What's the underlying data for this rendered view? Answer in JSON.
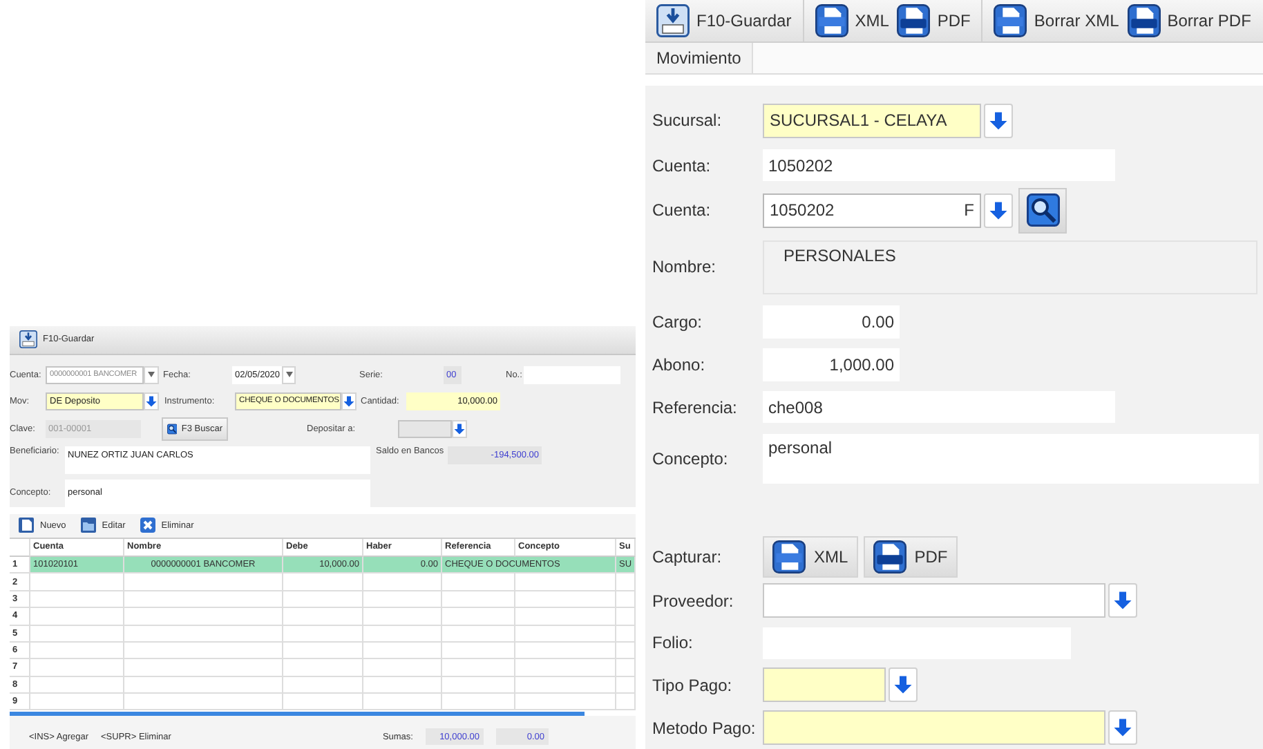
{
  "left_panel": {
    "toolbar": [
      {
        "label": "F10-Guardar",
        "kind": "save"
      }
    ],
    "form": {
      "cuenta": {
        "label": "Cuenta:",
        "value": "0000000001 BANCOMER"
      },
      "fecha": {
        "label": "Fecha:",
        "value": "02/05/2020"
      },
      "serie": {
        "label": "Serie:",
        "value": "00"
      },
      "no": {
        "label": "No.:"
      },
      "mov": {
        "label": "Mov:",
        "value": "DE Deposito"
      },
      "instrumento": {
        "label": "Instrumento:",
        "value": "CHEQUE O DOCUMENTOS"
      },
      "cantidad": {
        "label": "Cantidad:",
        "value": "10,000.00"
      },
      "clave": {
        "label": "Clave:",
        "value": "001-00001"
      },
      "buscar_button": {
        "label": "F3 Buscar"
      },
      "depositar": {
        "label": "Depositar a:"
      },
      "beneficiario": {
        "label": "Beneficiario:",
        "value": "NUNEZ ORTIZ JUAN CARLOS"
      },
      "saldo": {
        "label": "Saldo en Bancos",
        "value": "-194,500.00"
      },
      "concepto": {
        "label": "Concepto:",
        "value": "personal"
      }
    },
    "grid_toolbar": [
      {
        "label": "Nuevo",
        "kind": "new"
      },
      {
        "label": "Editar",
        "kind": "edit"
      },
      {
        "label": "Eliminar",
        "kind": "delete"
      }
    ],
    "table": {
      "columns": [
        "Cuenta",
        "Nombre",
        "Debe",
        "Haber",
        "Referencia",
        "Concepto",
        "Su"
      ],
      "rows": [
        {
          "number": "1",
          "selected": true,
          "cells": [
            "101020101",
            "0000000001 BANCOMER",
            "10,000.00",
            "0.00",
            "CHEQUE O DOCUMENTOS",
            null,
            "SU"
          ]
        },
        {
          "number": "2",
          "selected": false
        },
        {
          "number": "3",
          "selected": false
        },
        {
          "number": "4",
          "selected": false
        },
        {
          "number": "5",
          "selected": false
        },
        {
          "number": "6",
          "selected": false
        },
        {
          "number": "7",
          "selected": false
        },
        {
          "number": "8",
          "selected": false
        },
        {
          "number": "9",
          "selected": false
        }
      ]
    },
    "footer": {
      "hints": [
        "<INS> Agregar",
        "<SUPR> Eliminar"
      ],
      "sums_label": "Sumas:",
      "sums": [
        "10,000.00",
        "0.00"
      ]
    }
  },
  "right_panel": {
    "toolbar": [
      {
        "label": "F10-Guardar",
        "kind": "save",
        "separator_after": true
      },
      {
        "label": "XML",
        "kind": "xml",
        "separator_after": false
      },
      {
        "label": "PDF",
        "kind": "pdf",
        "separator_after": true
      },
      {
        "label": "Borrar XML",
        "kind": "xml",
        "separator_after": false
      },
      {
        "label": "Borrar PDF",
        "kind": "pdf",
        "separator_after": false
      }
    ],
    "tabs": [
      {
        "label": "Movimiento",
        "selected": true
      }
    ],
    "fields": [
      {
        "kind": "select",
        "label": "Sucursal:",
        "value": "SUCURSAL1 - CELAYA",
        "highlighted": true
      },
      {
        "kind": "text",
        "label": "Cuenta:",
        "value": "1050202",
        "readonly": false
      },
      {
        "kind": "lookup",
        "label": "Cuenta:",
        "value": "1050202",
        "suffix": "F"
      },
      {
        "kind": "memo",
        "label": "Nombre:",
        "value": "PERSONALES",
        "readonly": true
      },
      {
        "kind": "amount",
        "label": "Cargo:",
        "value": "0.00"
      },
      {
        "kind": "amount",
        "label": "Abono:",
        "value": "1,000.00"
      },
      {
        "kind": "text",
        "label": "Referencia:",
        "value": "che008",
        "readonly": false
      },
      {
        "kind": "memo",
        "label": "Concepto:",
        "value": "personal",
        "readonly": false
      },
      {
        "kind": "buttons",
        "label": "Capturar:",
        "buttons": [
          {
            "label": "XML",
            "kind": "xml"
          },
          {
            "label": "PDF",
            "kind": "pdf"
          }
        ]
      },
      {
        "kind": "select",
        "label": "Proveedor:",
        "highlighted": false
      },
      {
        "kind": "text",
        "label": "Folio:",
        "readonly": false
      },
      {
        "kind": "select",
        "label": "Tipo Pago:",
        "highlighted": true
      },
      {
        "kind": "select",
        "label": "Metodo Pago:",
        "highlighted": true
      }
    ]
  }
}
